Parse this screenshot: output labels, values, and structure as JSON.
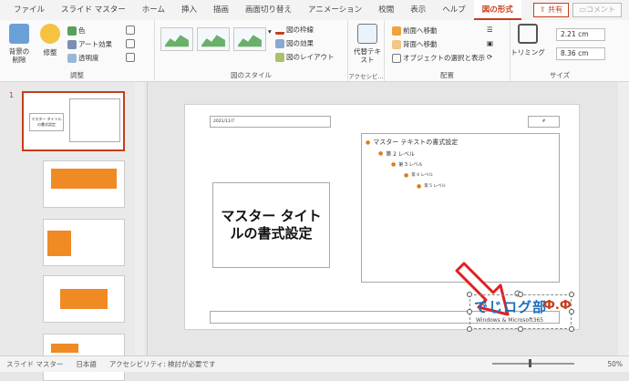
{
  "tabs": [
    "ファイル",
    "スライド マスター",
    "ホーム",
    "挿入",
    "描画",
    "画面切り替え",
    "アニメーション",
    "校閲",
    "表示",
    "ヘルプ",
    "図の形式"
  ],
  "share_label": "共有",
  "comment_label": "コメント",
  "ribbon": {
    "remove_bg": "背景の削除",
    "corrections": "修整",
    "color": "色",
    "art_effects": "アート効果",
    "transparency": "透明度",
    "adjust_group": "調整",
    "picture_styles_group": "図のスタイル",
    "border": "図の枠線",
    "effects": "図の効果",
    "layout": "図のレイアウト",
    "alt_text": "代替テキスト",
    "accessibility_group": "アクセシビ...",
    "bring_forward": "前面へ移動",
    "send_backward": "背面へ移動",
    "selection_pane": "オブジェクトの選択と表示",
    "arrange_group": "配置",
    "crop": "トリミング",
    "height": "2.21 cm",
    "width": "8.36 cm",
    "size_group": "サイズ"
  },
  "thumbs": {
    "first_number": "1",
    "first_title": "マスター タイトルの書式設定"
  },
  "slide": {
    "date": "2021/11/7",
    "num": "#",
    "title": "マスター タイトルの書式設定",
    "levels": [
      "マスター テキストの書式設定",
      "第 2 レベル",
      "第 3 レベル",
      "第 4 レベル",
      "第 5 レベル"
    ],
    "logo_text": "でじログ部",
    "logo_sub": "Windows & Microsoft365",
    "logo_icon": "Ф.Ф"
  },
  "status": {
    "view": "スライド マスター",
    "lang": "日本語",
    "access": "アクセシビリティ: 検討が必要です",
    "zoom": "50%"
  },
  "colors": {
    "accent": "#c43e1c",
    "logo": "#1a6fbd",
    "arrow": "#e02020"
  }
}
